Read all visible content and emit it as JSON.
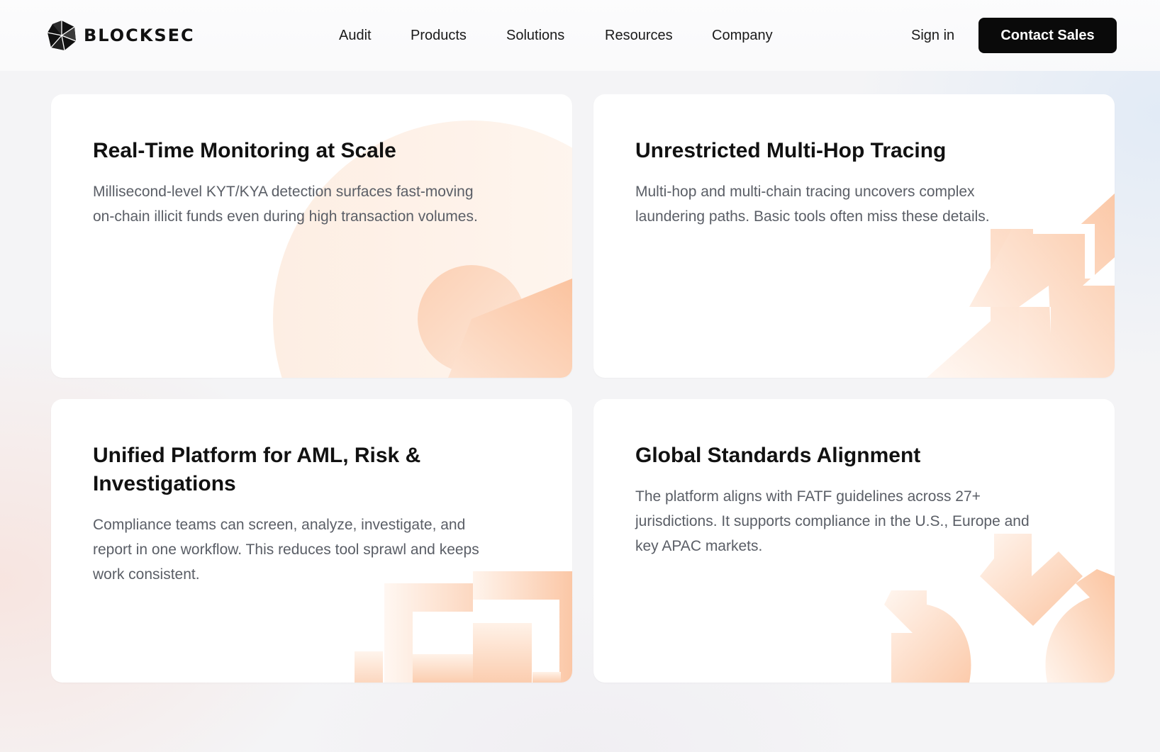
{
  "header": {
    "logo_text": "BLOCKSEC",
    "nav": [
      "Audit",
      "Products",
      "Solutions",
      "Resources",
      "Company"
    ],
    "sign_in": "Sign in",
    "cta": "Contact Sales"
  },
  "cards": [
    {
      "title": "Real-Time Monitoring at Scale",
      "description": "Millisecond-level KYT/KYA detection surfaces fast-moving on-chain illicit funds even during high transaction volumes.",
      "illustration": "radar-chart-illustration"
    },
    {
      "title": "Unrestricted Multi-Hop Tracing",
      "description": "Multi-hop and multi-chain tracing uncovers complex laundering paths. Basic tools often miss these details.",
      "illustration": "arrow-path-illustration"
    },
    {
      "title": "Unified Platform for AML, Risk & Investigations",
      "description": "Compliance teams can screen, analyze, investigate, and report in one workflow. This reduces tool sprawl and keeps work consistent.",
      "illustration": "stacked-blocks-illustration"
    },
    {
      "title": "Global Standards Alignment",
      "description": "The platform aligns with FATF guidelines across 27+ jurisdictions. It supports compliance in the U.S., Europe and key APAC markets.",
      "illustration": "converging-arrows-illustration"
    }
  ],
  "colors": {
    "accent_peach": "#fbc7a6",
    "cta_background": "#0a0a0a",
    "card_background": "#ffffff"
  }
}
